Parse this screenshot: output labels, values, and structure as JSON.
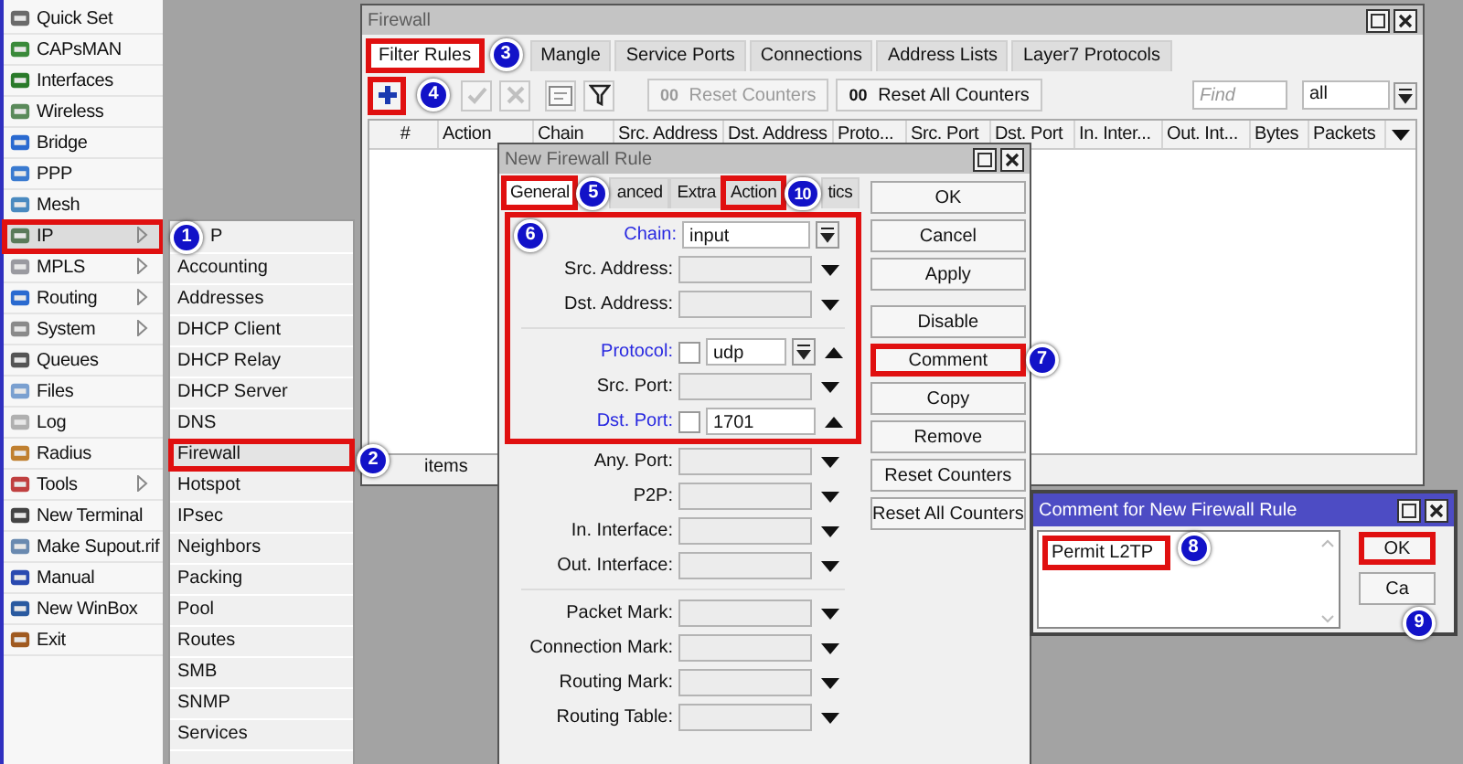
{
  "main_menu": [
    {
      "label": "Quick Set",
      "has_submenu": false,
      "highlighted": false
    },
    {
      "label": "CAPsMAN",
      "has_submenu": false,
      "highlighted": false
    },
    {
      "label": "Interfaces",
      "has_submenu": false,
      "highlighted": false
    },
    {
      "label": "Wireless",
      "has_submenu": false,
      "highlighted": false
    },
    {
      "label": "Bridge",
      "has_submenu": false,
      "highlighted": false
    },
    {
      "label": "PPP",
      "has_submenu": false,
      "highlighted": false
    },
    {
      "label": "Mesh",
      "has_submenu": false,
      "highlighted": false
    },
    {
      "label": "IP",
      "has_submenu": true,
      "highlighted": true
    },
    {
      "label": "MPLS",
      "has_submenu": true,
      "highlighted": false
    },
    {
      "label": "Routing",
      "has_submenu": true,
      "highlighted": false
    },
    {
      "label": "System",
      "has_submenu": true,
      "highlighted": false
    },
    {
      "label": "Queues",
      "has_submenu": false,
      "highlighted": false
    },
    {
      "label": "Files",
      "has_submenu": false,
      "highlighted": false
    },
    {
      "label": "Log",
      "has_submenu": false,
      "highlighted": false
    },
    {
      "label": "Radius",
      "has_submenu": false,
      "highlighted": false
    },
    {
      "label": "Tools",
      "has_submenu": true,
      "highlighted": false
    },
    {
      "label": "New Terminal",
      "has_submenu": false,
      "highlighted": false
    },
    {
      "label": "Make Supout.rif",
      "has_submenu": false,
      "highlighted": false
    },
    {
      "label": "Manual",
      "has_submenu": false,
      "highlighted": false
    },
    {
      "label": "New WinBox",
      "has_submenu": false,
      "highlighted": false
    },
    {
      "label": "Exit",
      "has_submenu": false,
      "highlighted": false
    }
  ],
  "ip_submenu": [
    {
      "label": "P",
      "highlighted": false
    },
    {
      "label": "Accounting",
      "highlighted": false
    },
    {
      "label": "Addresses",
      "highlighted": false
    },
    {
      "label": "DHCP Client",
      "highlighted": false
    },
    {
      "label": "DHCP Relay",
      "highlighted": false
    },
    {
      "label": "DHCP Server",
      "highlighted": false
    },
    {
      "label": "DNS",
      "highlighted": false
    },
    {
      "label": "Firewall",
      "highlighted": true
    },
    {
      "label": "Hotspot",
      "highlighted": false
    },
    {
      "label": "IPsec",
      "highlighted": false
    },
    {
      "label": "Neighbors",
      "highlighted": false
    },
    {
      "label": "Packing",
      "highlighted": false
    },
    {
      "label": "Pool",
      "highlighted": false
    },
    {
      "label": "Routes",
      "highlighted": false
    },
    {
      "label": "SMB",
      "highlighted": false
    },
    {
      "label": "SNMP",
      "highlighted": false
    },
    {
      "label": "Services",
      "highlighted": false
    }
  ],
  "firewall": {
    "title": "Firewall",
    "tabs": [
      {
        "label": "Filter Rules",
        "selected": true,
        "highlighted": true
      },
      {
        "label": "Mangle",
        "selected": false,
        "highlighted": false
      },
      {
        "label": "Service Ports",
        "selected": false,
        "highlighted": false
      },
      {
        "label": "Connections",
        "selected": false,
        "highlighted": false
      },
      {
        "label": "Address Lists",
        "selected": false,
        "highlighted": false
      },
      {
        "label": "Layer7 Protocols",
        "selected": false,
        "highlighted": false
      }
    ],
    "add_highlighted": true,
    "counter_buttons": [
      {
        "icon_text": "00",
        "label": "Reset Counters",
        "disabled": true
      },
      {
        "icon_text": "00",
        "label": "Reset All Counters",
        "disabled": false
      }
    ],
    "find_placeholder": "Find",
    "filter_value": "all",
    "columns": [
      "#",
      "Action",
      "Chain",
      "Src. Address",
      "Dst. Address",
      "Proto...",
      "Src. Port",
      "Dst. Port",
      "In. Inter...",
      "Out. Int...",
      "Bytes",
      "Packets"
    ],
    "status": "items"
  },
  "rule_dialog": {
    "title": "New Firewall Rule",
    "tabs": [
      {
        "label": "General",
        "selected": true,
        "highlighted": true
      },
      {
        "label": "anced",
        "selected": false,
        "highlighted": false
      },
      {
        "label": "Extra",
        "selected": false,
        "highlighted": false
      },
      {
        "label": "Action",
        "selected": false,
        "highlighted": true
      },
      {
        "label": "tics",
        "selected": false,
        "highlighted": false
      }
    ],
    "field_groups": [
      {
        "highlighted": true,
        "sections": [
          {
            "fields": [
              {
                "label": "Chain:",
                "kind": "select",
                "value": "input",
                "emphasized": true
              },
              {
                "label": "Src. Address:",
                "kind": "dropdown",
                "emphasized": false
              },
              {
                "label": "Dst. Address:",
                "kind": "dropdown",
                "emphasized": false
              }
            ]
          },
          {
            "fields": [
              {
                "label": "Protocol:",
                "kind": "negatable_select",
                "value": "udp",
                "checked": false,
                "emphasized": true
              },
              {
                "label": "Src. Port:",
                "kind": "dropdown",
                "emphasized": false
              },
              {
                "label": "Dst. Port:",
                "kind": "negatable",
                "value": "1701",
                "checked": false,
                "emphasized": true
              }
            ]
          }
        ]
      },
      {
        "highlighted": false,
        "sections": [
          {
            "fields": [
              {
                "label": "Any. Port:",
                "kind": "dropdown",
                "emphasized": false
              },
              {
                "label": "P2P:",
                "kind": "dropdown",
                "emphasized": false
              },
              {
                "label": "In. Interface:",
                "kind": "dropdown",
                "emphasized": false
              },
              {
                "label": "Out. Interface:",
                "kind": "dropdown",
                "emphasized": false
              }
            ]
          },
          {
            "fields": [
              {
                "label": "Packet Mark:",
                "kind": "dropdown",
                "emphasized": false
              },
              {
                "label": "Connection Mark:",
                "kind": "dropdown",
                "emphasized": false
              },
              {
                "label": "Routing Mark:",
                "kind": "dropdown",
                "emphasized": false
              },
              {
                "label": "Routing Table:",
                "kind": "dropdown",
                "emphasized": false
              }
            ]
          }
        ]
      }
    ],
    "buttons": [
      {
        "label": "OK",
        "highlighted": false
      },
      {
        "label": "Cancel",
        "highlighted": false
      },
      {
        "label": "Apply",
        "highlighted": false
      },
      {
        "label": "Disable",
        "highlighted": false
      },
      {
        "label": "Comment",
        "highlighted": true
      },
      {
        "label": "Copy",
        "highlighted": false
      },
      {
        "label": "Remove",
        "highlighted": false
      },
      {
        "label": "Reset Counters",
        "highlighted": false
      },
      {
        "label": "Reset All Counters",
        "highlighted": false
      }
    ]
  },
  "comment_dialog": {
    "title": "Comment for New Firewall Rule",
    "text": "Permit L2TP",
    "text_highlighted": true,
    "buttons": [
      {
        "label": "OK",
        "highlighted": true
      },
      {
        "label": "Ca",
        "highlighted": false
      }
    ]
  },
  "annotations": [
    {
      "number": "1"
    },
    {
      "number": "2"
    },
    {
      "number": "3"
    },
    {
      "number": "4"
    },
    {
      "number": "5"
    },
    {
      "number": "6"
    },
    {
      "number": "7"
    },
    {
      "number": "8"
    },
    {
      "number": "9"
    },
    {
      "number": "10"
    }
  ]
}
